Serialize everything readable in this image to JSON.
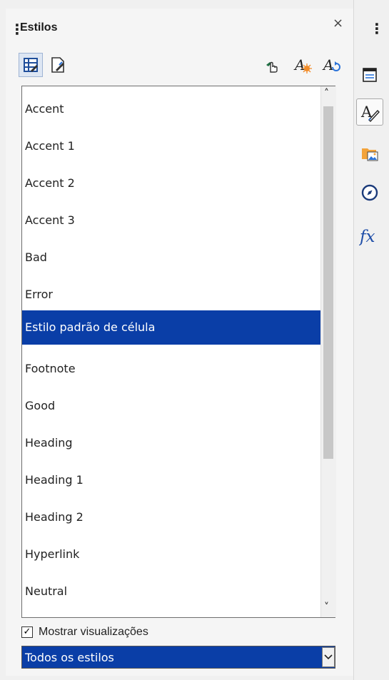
{
  "panel": {
    "title": "Estilos",
    "close_glyph": "×",
    "toolbar": [
      {
        "name": "cell-styles-icon",
        "active": true
      },
      {
        "name": "page-styles-icon",
        "active": false
      },
      {
        "name": "fill-format-mode-icon",
        "active": false
      },
      {
        "name": "new-style-from-selection-icon",
        "active": false
      },
      {
        "name": "update-style-icon",
        "active": false
      }
    ],
    "styles": [
      "Accent",
      "Accent 1",
      "Accent 2",
      "Accent 3",
      "Bad",
      "Error",
      "Estilo padrão de célula",
      "Footnote",
      "Good",
      "Heading",
      "Heading 1",
      "Heading 2",
      "Hyperlink",
      "Neutral"
    ],
    "selected_index": 6,
    "show_previews_label": "Mostrar visualizações",
    "show_previews_checked": true,
    "filter_value": "Todos os estilos"
  },
  "sidebar": {
    "buttons": [
      {
        "name": "properties-icon",
        "active": false
      },
      {
        "name": "styles-icon",
        "active": true
      },
      {
        "name": "gallery-icon",
        "active": false
      },
      {
        "name": "navigator-icon",
        "active": false
      },
      {
        "name": "functions-icon",
        "active": false
      }
    ]
  },
  "colors": {
    "accent": "#0a3ea7",
    "selected_text": "#ffffff"
  }
}
